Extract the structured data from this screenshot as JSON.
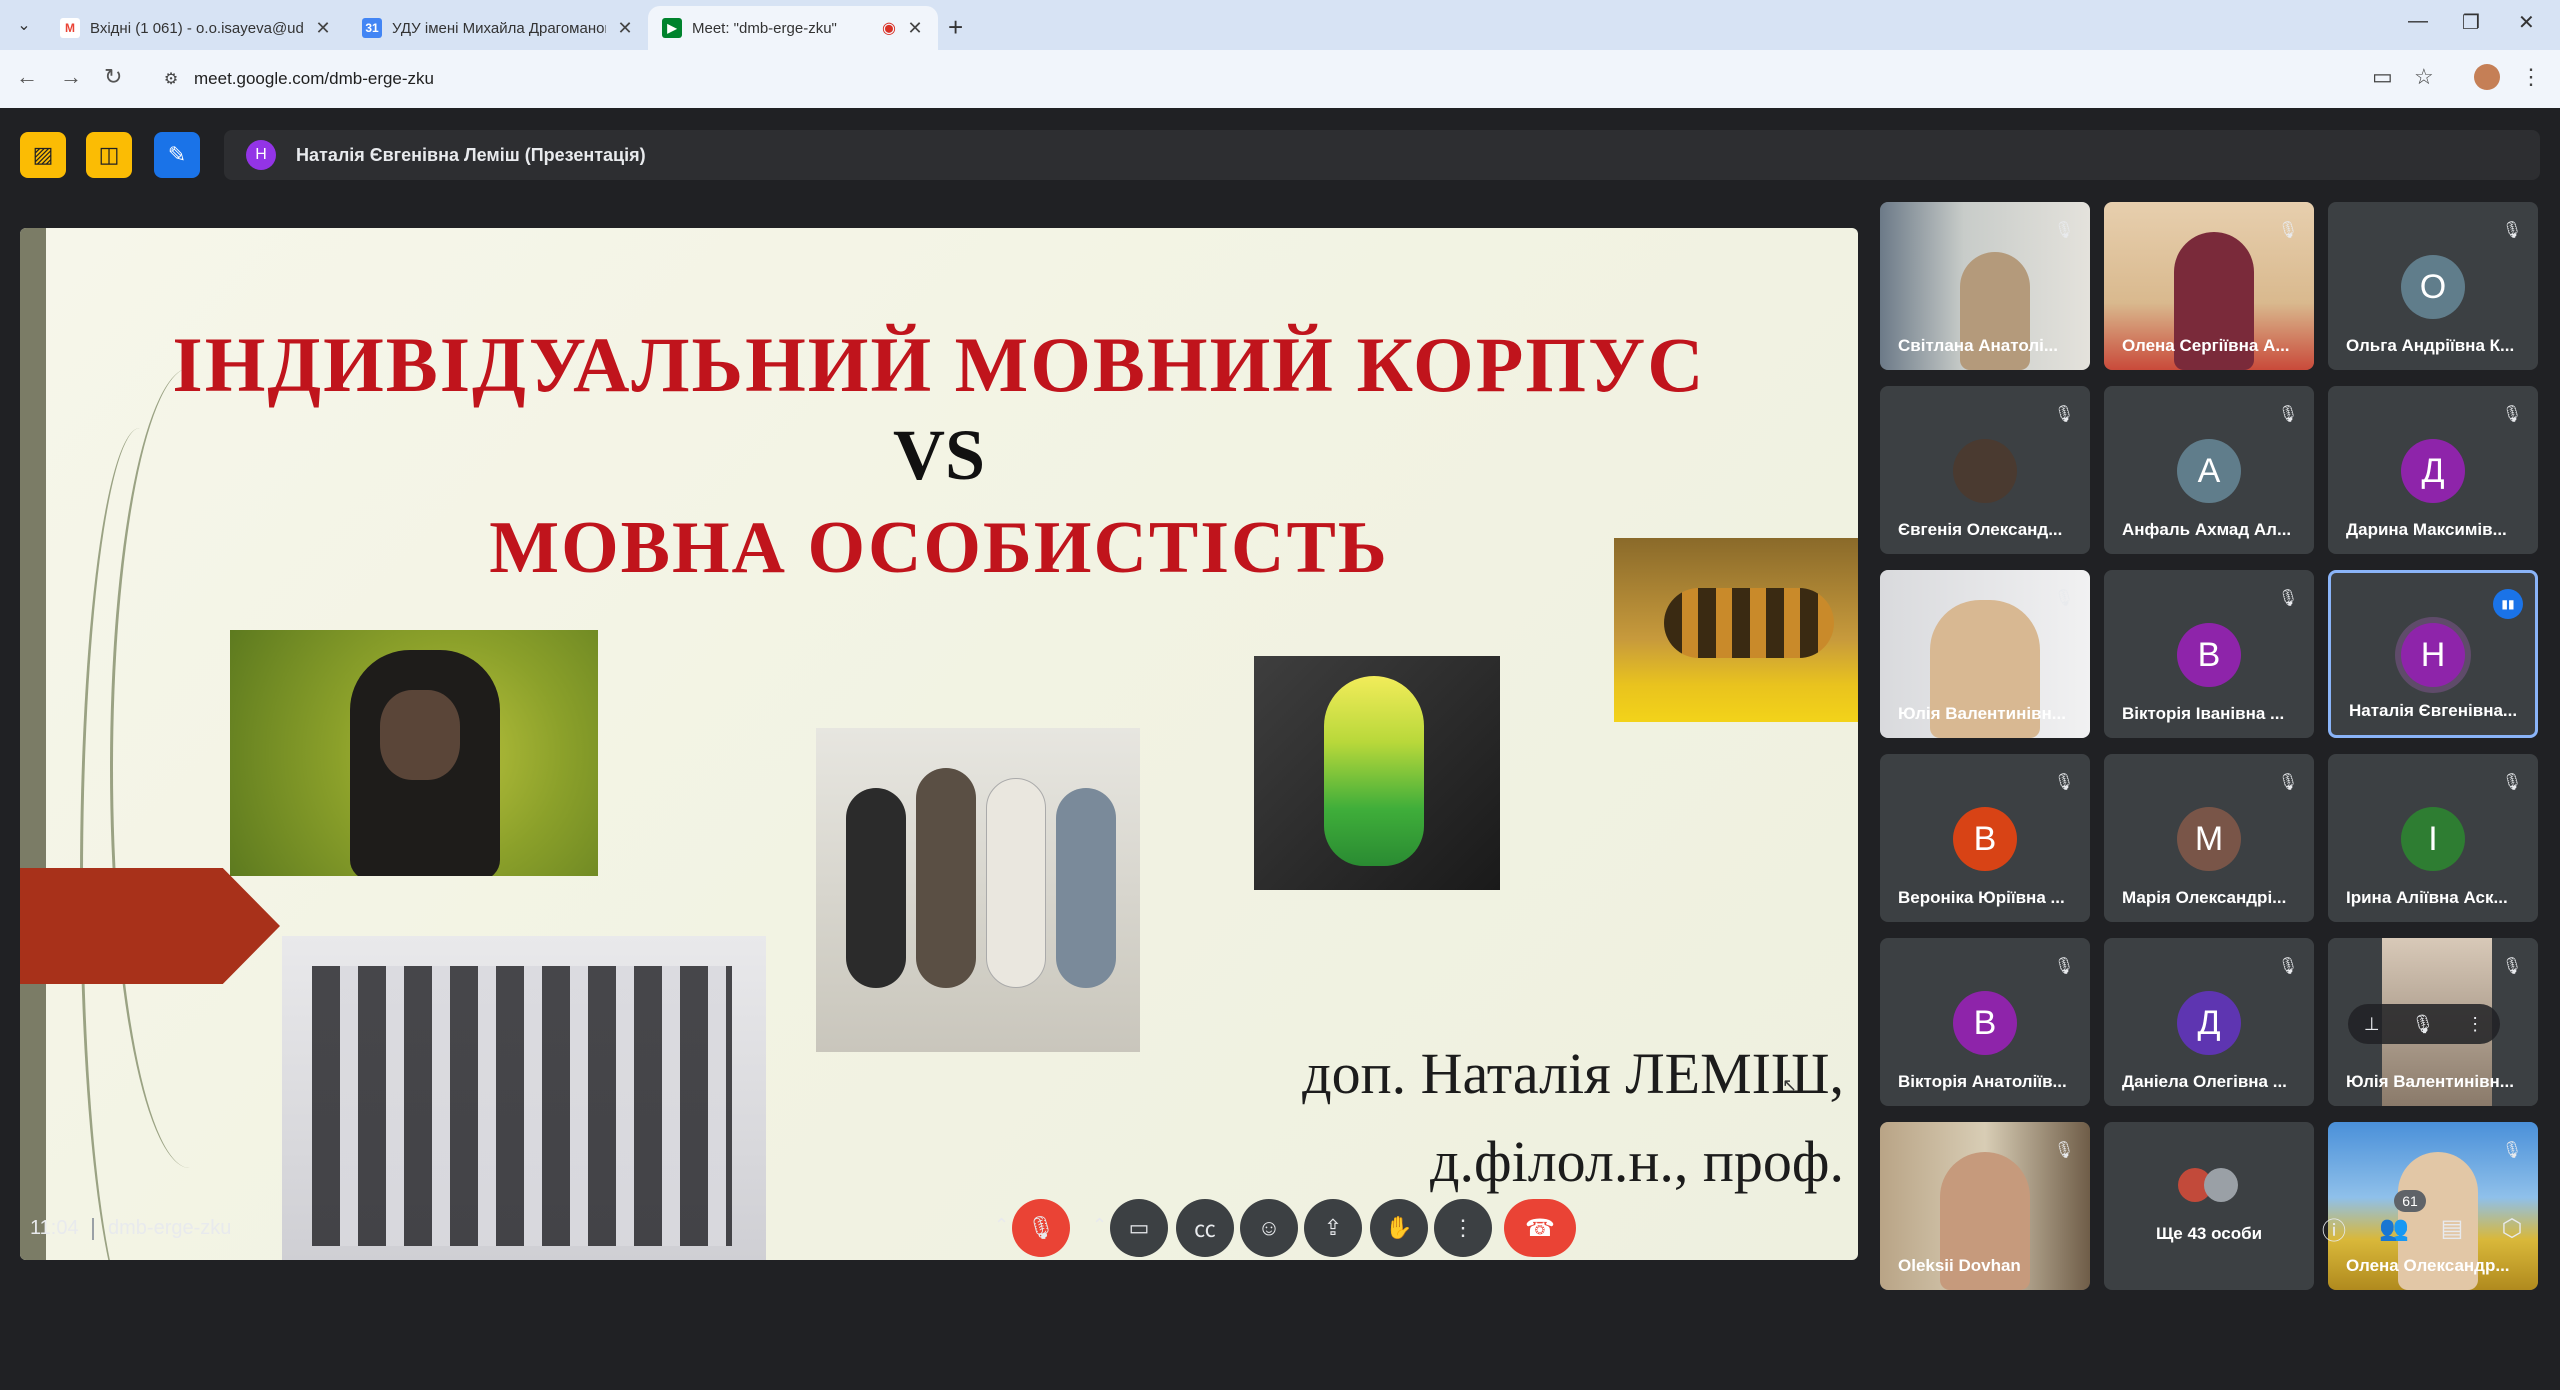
{
  "browser": {
    "tabs": [
      {
        "title": "Вхідні (1 061) - o.o.isayeva@ud",
        "favicon": "gmail-icon"
      },
      {
        "title": "УДУ імені Михайла Драгоманова",
        "favicon": "calendar-icon"
      },
      {
        "title": "Meet: \"dmb-erge-zku\"",
        "favicon": "meet-icon"
      }
    ],
    "url": "meet.google.com/dmb-erge-zku"
  },
  "meet": {
    "presenter_initial": "Н",
    "presenter_label": "Наталія Євгенівна Леміш (Презентація)",
    "slide": {
      "title_line1": "ІНДИВІДУАЛЬНИЙ МОВНИЙ КОРПУС",
      "title_vs": "VS",
      "title_line2": "МОВНА ОСОБИСТІСТЬ",
      "author_line1": "доп. Наталія ЛЕМІШ,",
      "author_line2": "д.філол.н., проф."
    },
    "participants": [
      {
        "name": "Світлана Анатолі...",
        "type": "video"
      },
      {
        "name": "Олена Сергіївна А...",
        "type": "video"
      },
      {
        "name": "Ольга Андріївна К...",
        "initial": "О",
        "color": "#607d8b"
      },
      {
        "name": "Євгенія Олександ...",
        "type": "photo"
      },
      {
        "name": "Анфаль Ахмад Ал...",
        "initial": "А",
        "color": "#607d8b"
      },
      {
        "name": "Дарина Максимів...",
        "initial": "Д",
        "color": "#8e24aa"
      },
      {
        "name": "Юлія Валентинівн...",
        "type": "video"
      },
      {
        "name": "Вікторія Іванівна ...",
        "initial": "В",
        "color": "#8e24aa"
      },
      {
        "name": "Наталія Євгенівна...",
        "initial": "Н",
        "color": "#8e24aa"
      },
      {
        "name": "Вероніка Юріївна ...",
        "initial": "В",
        "color": "#d84315"
      },
      {
        "name": "Марія Олександрі...",
        "initial": "М",
        "color": "#795548"
      },
      {
        "name": "Ірина Аліївна Аск...",
        "initial": "І",
        "color": "#2e7d32"
      },
      {
        "name": "Вікторія Анатоліїв...",
        "initial": "В",
        "color": "#8e24aa"
      },
      {
        "name": "Даніела Олегівна ...",
        "initial": "Д",
        "color": "#5e35b1"
      },
      {
        "name": "Юлія Валентинівн...",
        "type": "video"
      },
      {
        "name": "Oleksii Dovhan",
        "type": "video"
      },
      {
        "name": "Ще 43 особи",
        "type": "more"
      },
      {
        "name": "Олена Олександр...",
        "type": "video"
      }
    ],
    "bottom": {
      "time": "11:04",
      "meeting_code": "dmb-erge-zku",
      "people_count": "61"
    }
  }
}
